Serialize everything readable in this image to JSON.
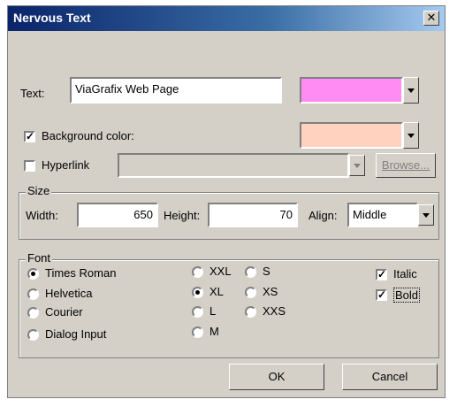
{
  "window": {
    "title": "Nervous Text",
    "close_glyph": "✕"
  },
  "text_row": {
    "label": "Text:",
    "value": "ViaGrafix Web Page",
    "color": "#ff8cf2"
  },
  "background_row": {
    "checked": true,
    "label": "Background color:",
    "color": "#ffd2bf"
  },
  "hyperlink_row": {
    "checked": false,
    "label": "Hyperlink",
    "value": "",
    "browse_label": "Browse..."
  },
  "size": {
    "legend": "Size",
    "width_label": "Width:",
    "width_value": "650",
    "height_label": "Height:",
    "height_value": "70",
    "align_label": "Align:",
    "align_value": "Middle"
  },
  "font": {
    "legend": "Font",
    "families": [
      {
        "label": "Times Roman",
        "selected": true
      },
      {
        "label": "Helvetica",
        "selected": false
      },
      {
        "label": "Courier",
        "selected": false
      },
      {
        "label": "Dialog Input",
        "selected": false
      }
    ],
    "sizes_col1": [
      {
        "label": "XXL",
        "selected": false
      },
      {
        "label": "XL",
        "selected": true
      },
      {
        "label": "L",
        "selected": false
      },
      {
        "label": "M",
        "selected": false
      }
    ],
    "sizes_col2": [
      {
        "label": "S",
        "selected": false
      },
      {
        "label": "XS",
        "selected": false
      },
      {
        "label": "XXS",
        "selected": false
      }
    ],
    "italic": {
      "label": "Italic",
      "checked": true
    },
    "bold": {
      "label": "Bold",
      "checked": true
    }
  },
  "buttons": {
    "ok": "OK",
    "cancel": "Cancel"
  }
}
